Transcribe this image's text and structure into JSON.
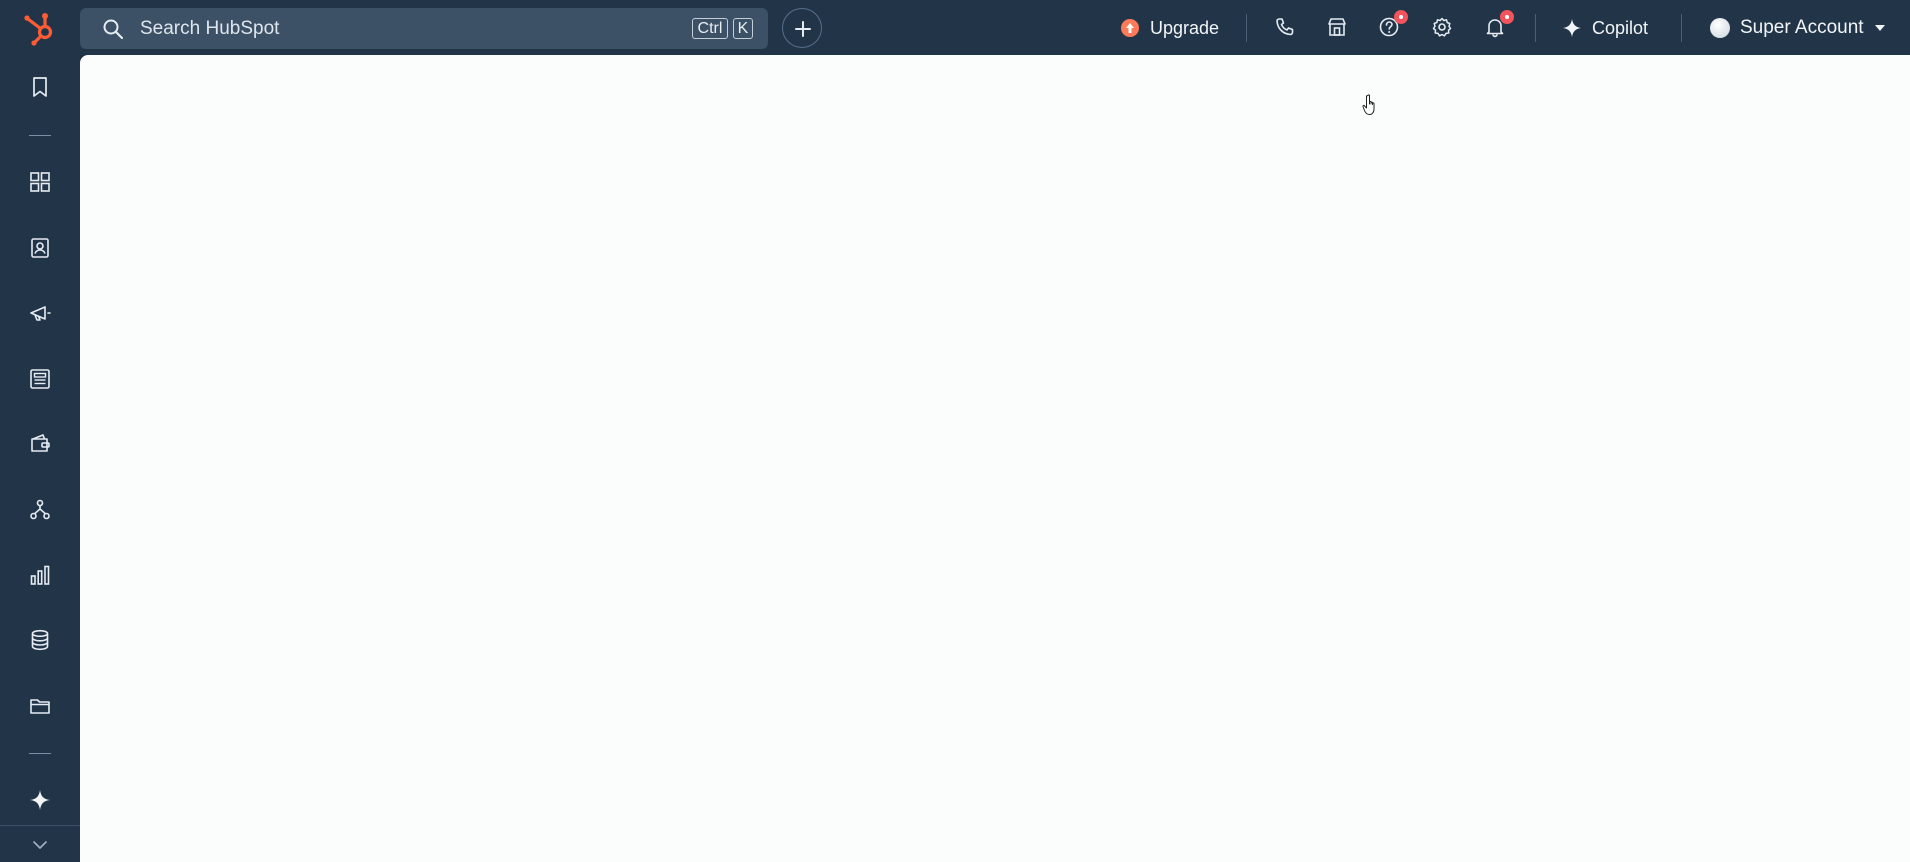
{
  "topbar": {
    "search_placeholder": "Search HubSpot",
    "shortcut_ctrl": "Ctrl",
    "shortcut_key": "K",
    "upgrade_label": "Upgrade",
    "copilot_label": "Copilot",
    "account_name": "Super Account",
    "icons": [
      "hubspot-logo",
      "search-icon",
      "plus-icon",
      "upgrade-icon",
      "phone-icon",
      "marketplace-icon",
      "help-icon",
      "settings-icon",
      "bell-icon",
      "sparkle-icon",
      "avatar",
      "caret-down-icon"
    ],
    "notifications": {
      "help": true,
      "bell": true
    }
  },
  "sidebar": {
    "items": [
      "bookmark-icon",
      "dashboard-icon",
      "contacts-icon",
      "marketing-icon",
      "content-icon",
      "commerce-icon",
      "automation-icon",
      "reporting-icon",
      "data-icon",
      "library-icon",
      "copilot-sparkle-icon",
      "expand-chevron-icon"
    ]
  },
  "colors": {
    "nav_bg": "#223548",
    "search_bg": "#3c5066",
    "main_bg": "#fbfdfd",
    "brand_orange": "#ff5c35",
    "badge_red": "#f2545b",
    "upgrade_orange": "#ff7a59"
  }
}
